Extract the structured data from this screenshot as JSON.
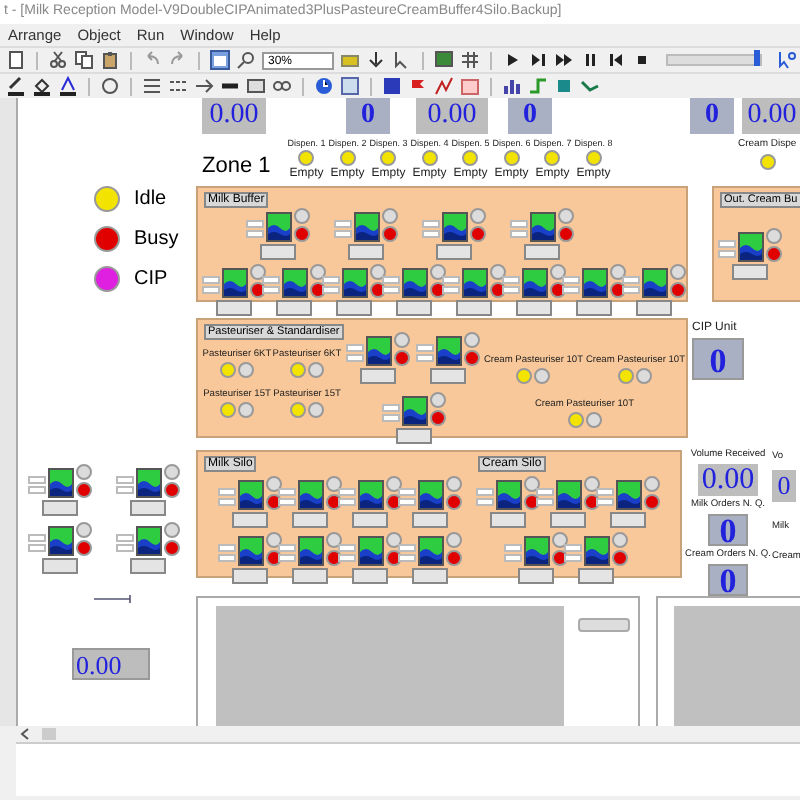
{
  "window": {
    "title": "t - [Milk Reception Model-V9DoubleCIPAnimated3PlusPasteureCreamBuffer4Silo.Backup]"
  },
  "menu": [
    "Arrange",
    "Object",
    "Run",
    "Window",
    "Help"
  ],
  "toolbar": {
    "zoom": "30%",
    "speed_slider": {
      "level": 0.93
    }
  },
  "top_displays": [
    {
      "kind": "number",
      "value": "0.00"
    },
    {
      "kind": "queue",
      "value": "0"
    },
    {
      "kind": "number",
      "value": "0.00"
    },
    {
      "kind": "queue",
      "value": "0"
    },
    {
      "kind": "queue",
      "value": "0"
    },
    {
      "kind": "number",
      "value": "0.00"
    }
  ],
  "zone": {
    "title": "Zone 1",
    "dispensers": [
      {
        "label": "Dispen. 1",
        "color": "#f2e400",
        "reading": "Empty"
      },
      {
        "label": "Dispen. 2",
        "color": "#f2e400",
        "reading": "Empty"
      },
      {
        "label": "Dispen. 3",
        "color": "#f2e400",
        "reading": "Empty"
      },
      {
        "label": "Dispen. 4",
        "color": "#f2e400",
        "reading": "Empty"
      },
      {
        "label": "Dispen. 5",
        "color": "#f2e400",
        "reading": "Empty"
      },
      {
        "label": "Dispen. 6",
        "color": "#f2e400",
        "reading": "Empty"
      },
      {
        "label": "Dispen. 7",
        "color": "#f2e400",
        "reading": "Empty"
      },
      {
        "label": "Dispen. 8",
        "color": "#f2e400",
        "reading": "Empty"
      }
    ],
    "cream_dispenser": {
      "label": "Cream Dispe",
      "color": "#f2e400"
    }
  },
  "legend": [
    {
      "label": "Idle",
      "color": "#f2e400"
    },
    {
      "label": "Busy",
      "color": "#e00000"
    },
    {
      "label": "CIP",
      "color": "#e020e0"
    }
  ],
  "milk_buffer": {
    "title": "Milk Buffer",
    "tanks": [
      {
        "color": "#e00000"
      },
      {
        "color": "#e00000"
      },
      {
        "color": "#e00000"
      },
      {
        "color": "#e00000"
      },
      {
        "color": "#e00000"
      },
      {
        "color": "#e00000"
      },
      {
        "color": "#e00000"
      },
      {
        "color": "#e00000"
      },
      {
        "color": "#e00000"
      },
      {
        "color": "#e00000"
      },
      {
        "color": "#e00000"
      },
      {
        "color": "#e00000"
      }
    ]
  },
  "cream_buffer": {
    "title": "Out. Cream Bu",
    "tanks": [
      {
        "color": "#e00000"
      }
    ]
  },
  "pasteuriser": {
    "title": "Pasteuriser & Standardiser",
    "units": [
      {
        "label": "Pasteuriser 6KT",
        "color": "#f2e400"
      },
      {
        "label": "Pasteuriser 6KT",
        "color": "#f2e400"
      },
      {
        "label": "Pasteuriser 15T",
        "color": "#f2e400"
      },
      {
        "label": "Pasteuriser 15T",
        "color": "#f2e400"
      }
    ],
    "tanks": [
      {
        "color": "#e00000"
      },
      {
        "color": "#e00000"
      },
      {
        "color": "#e00000"
      }
    ],
    "cream_units": [
      {
        "label": "Cream Pasteuriser 10T",
        "color": "#f2e400"
      },
      {
        "label": "Cream Pasteuriser 10T",
        "color": "#f2e400"
      },
      {
        "label": "Cream Pasteuriser 10T",
        "color": "#f2e400"
      }
    ]
  },
  "cip": {
    "title": "CIP Unit",
    "value": "0"
  },
  "silos": {
    "milk_title": "Milk Silo",
    "milk_tanks": [
      {
        "color": "#e00000"
      },
      {
        "color": "#e00000"
      },
      {
        "color": "#e00000"
      },
      {
        "color": "#e00000"
      },
      {
        "color": "#e00000"
      },
      {
        "color": "#e00000"
      },
      {
        "color": "#e00000"
      },
      {
        "color": "#e00000"
      }
    ],
    "cream_title": "Cream Silo",
    "cream_tanks": [
      {
        "color": "#e00000"
      },
      {
        "color": "#e00000"
      },
      {
        "color": "#e00000"
      },
      {
        "color": "#e00000"
      },
      {
        "color": "#e00000"
      }
    ]
  },
  "reception_tanks": [
    {
      "color": "#e00000"
    },
    {
      "color": "#e00000"
    },
    {
      "color": "#e00000"
    },
    {
      "color": "#e00000"
    }
  ],
  "stats": [
    {
      "label": "Volume Received",
      "value": "0.00",
      "kind": "number"
    },
    {
      "label": "Milk Orders N. Q.",
      "value": "0",
      "kind": "queue"
    },
    {
      "label": "Cream Orders N. Q.",
      "value": "0",
      "kind": "queue"
    }
  ],
  "stats_cut": [
    "Vo",
    "Milk",
    "Cream"
  ],
  "stats_cut_value": "0",
  "bottom_display": "0.00"
}
